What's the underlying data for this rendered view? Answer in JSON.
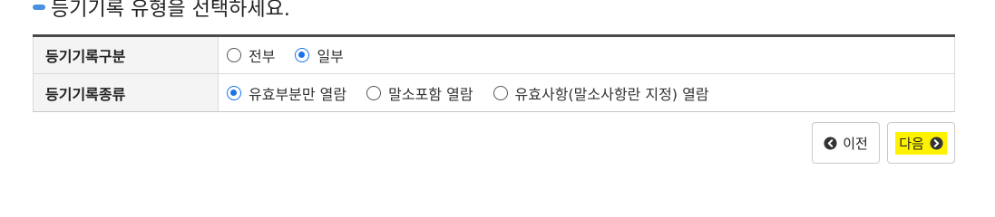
{
  "heading": {
    "text": "등기기록 유형을 선택하세요."
  },
  "table": {
    "rows": [
      {
        "label": "등기기록구분",
        "options": [
          {
            "label": "전부",
            "checked": false
          },
          {
            "label": "일부",
            "checked": true
          }
        ]
      },
      {
        "label": "등기기록종류",
        "options": [
          {
            "label": "유효부분만 열람",
            "checked": true
          },
          {
            "label": "말소포함 열람",
            "checked": false
          },
          {
            "label": "유효사항(말소사항란 지정) 열람",
            "checked": false
          }
        ]
      }
    ]
  },
  "buttons": {
    "prev": {
      "label": "이전",
      "icon": "arrow-left-circle-icon"
    },
    "next": {
      "label": "다음",
      "icon": "arrow-right-circle-icon",
      "highlight": "#fff200"
    }
  },
  "colors": {
    "accent": "#1a73e8",
    "heading_bullet": "#4a90e2",
    "table_border": "#4a4a4a"
  }
}
